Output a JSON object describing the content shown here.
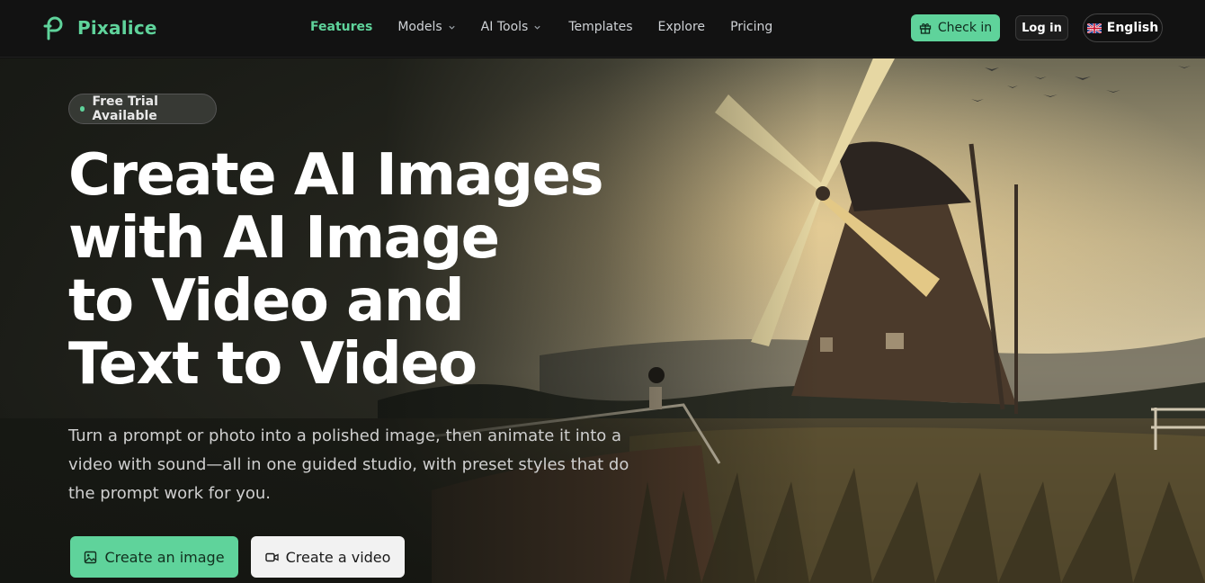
{
  "brand": {
    "name": "Pixalice",
    "accent": "#5fd39b"
  },
  "nav": {
    "items": [
      {
        "label": "Features",
        "active": true,
        "dropdown": false
      },
      {
        "label": "Models",
        "active": false,
        "dropdown": true
      },
      {
        "label": "AI Tools",
        "active": false,
        "dropdown": true
      },
      {
        "label": "Templates",
        "active": false,
        "dropdown": false
      },
      {
        "label": "Explore",
        "active": false,
        "dropdown": false
      },
      {
        "label": "Pricing",
        "active": false,
        "dropdown": false
      }
    ],
    "checkin_label": "Check in",
    "login_label": "Log in",
    "language_label": "English"
  },
  "hero": {
    "badge": "Free Trial Available",
    "headline": [
      "Create AI Images",
      "with AI Image",
      "to Video and",
      "Text to Video"
    ],
    "subtitle": "Turn a prompt or photo into a polished image, then animate it into a video with sound—all in one guided studio, with preset styles that do the prompt work for you.",
    "cta_primary": "Create an image",
    "cta_secondary": "Create a video"
  },
  "icons": {
    "logo": "pixalice-logo-icon",
    "checkin": "gift-icon",
    "language": "uk-flag-icon",
    "cta_primary": "image-icon",
    "cta_secondary": "video-camera-icon"
  }
}
